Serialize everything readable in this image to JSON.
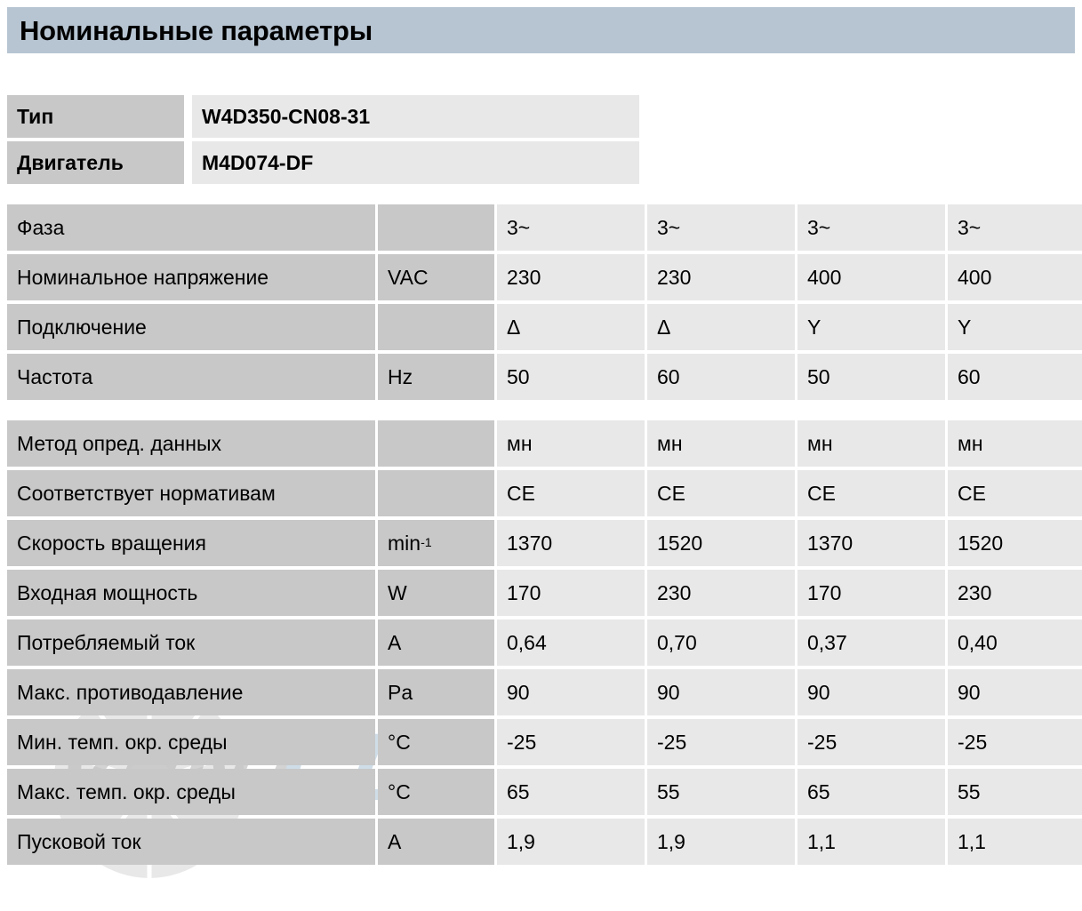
{
  "header": {
    "title": "Номинальные параметры",
    "banner_color": "#b7c5d2"
  },
  "identity": {
    "rows": [
      {
        "label": "Тип",
        "value": "W4D350-CN08-31"
      },
      {
        "label": "Двигатель",
        "value": "M4D074-DF"
      }
    ]
  },
  "electrical": {
    "rows": [
      {
        "label": "Фаза",
        "unit": "",
        "values": [
          "3~",
          "3~",
          "3~",
          "3~"
        ]
      },
      {
        "label": "Номинальное напряжение",
        "unit": "VAC",
        "values": [
          "230",
          "230",
          "400",
          "400"
        ]
      },
      {
        "label": "Подключение",
        "unit": "",
        "values": [
          "Δ",
          "Δ",
          "Y",
          "Y"
        ]
      },
      {
        "label": "Частота",
        "unit": "Hz",
        "values": [
          "50",
          "60",
          "50",
          "60"
        ]
      }
    ]
  },
  "performance": {
    "rows": [
      {
        "label": "Метод опред. данных",
        "unit": "",
        "unit_sup": "",
        "values": [
          "мн",
          "мн",
          "мн",
          "мн"
        ]
      },
      {
        "label": "Соответствует нормативам",
        "unit": "",
        "unit_sup": "",
        "values": [
          "CE",
          "CE",
          "CE",
          "CE"
        ]
      },
      {
        "label": "Скорость вращения",
        "unit": "min",
        "unit_sup": "-1",
        "values": [
          "1370",
          "1520",
          "1370",
          "1520"
        ]
      },
      {
        "label": "Входная мощность",
        "unit": "W",
        "unit_sup": "",
        "values": [
          "170",
          "230",
          "170",
          "230"
        ]
      },
      {
        "label": "Потребляемый ток",
        "unit": "A",
        "unit_sup": "",
        "values": [
          "0,64",
          "0,70",
          "0,37",
          "0,40"
        ]
      },
      {
        "label": "Макс. противодавление",
        "unit": "Pa",
        "unit_sup": "",
        "values": [
          "90",
          "90",
          "90",
          "90"
        ]
      },
      {
        "label": "Мин. темп. окр. среды",
        "unit": "°C",
        "unit_sup": "",
        "values": [
          "-25",
          "-25",
          "-25",
          "-25"
        ]
      },
      {
        "label": "Макс. темп. окр. среды",
        "unit": "°C",
        "unit_sup": "",
        "values": [
          "65",
          "55",
          "65",
          "55"
        ]
      },
      {
        "label": "Пусковой ток",
        "unit": "A",
        "unit_sup": "",
        "values": [
          "1,9",
          "1,9",
          "1,1",
          "1,1"
        ]
      }
    ]
  },
  "watermark": {
    "text_primary": "VENT",
    "text_secondary": "CL",
    "color_primary": "#b0b0b0",
    "color_secondary": "#a9c2d6"
  }
}
